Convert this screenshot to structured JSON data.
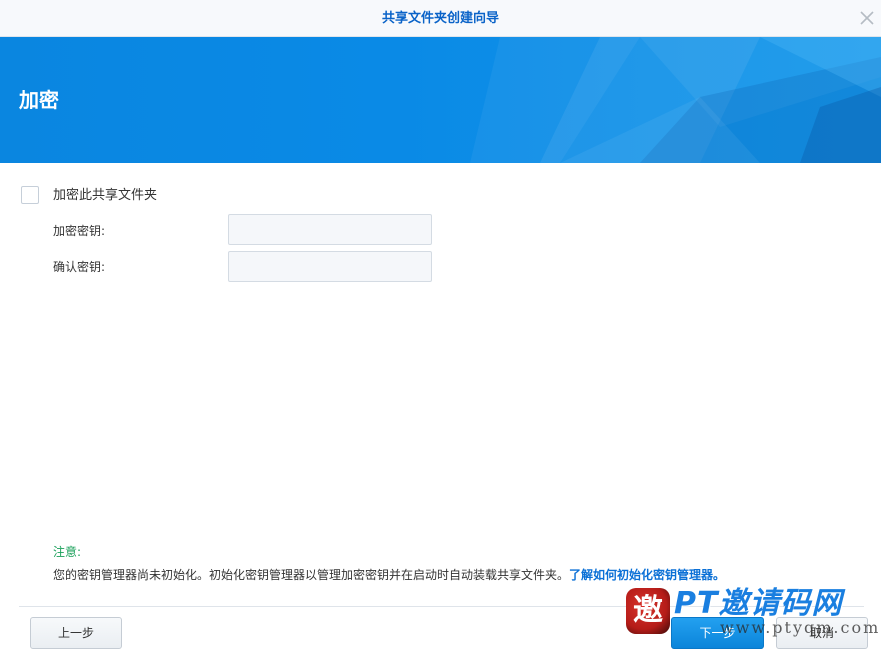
{
  "window": {
    "title": "共享文件夹创建向导"
  },
  "banner": {
    "heading": "加密"
  },
  "form": {
    "encrypt_checkbox_label": "加密此共享文件夹",
    "encrypt_checked": false,
    "key_label": "加密密钥:",
    "key_value": "",
    "confirm_label": "确认密钥:",
    "confirm_value": ""
  },
  "note": {
    "title": "注意:",
    "text": "您的密钥管理器尚未初始化。初始化密钥管理器以管理加密密钥并在启动时自动装载共享文件夹。",
    "link": "了解如何初始化密钥管理器。"
  },
  "footer": {
    "prev_label": "上一步",
    "next_label": "下一步",
    "cancel_label": "取消"
  },
  "watermark": {
    "seal": "邀",
    "title": "PT邀请码网",
    "url": "www.ptyqm.com"
  },
  "colors": {
    "accent": "#0a86e0",
    "title_text": "#0a63c8",
    "note_green": "#1aa05a",
    "link_blue": "#0b70d6"
  }
}
